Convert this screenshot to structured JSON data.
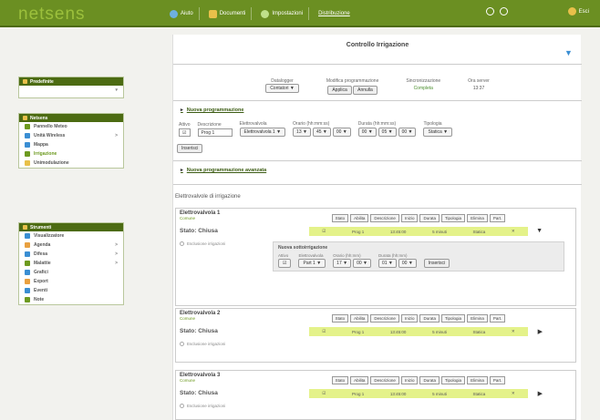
{
  "app": {
    "logo": "netsens"
  },
  "topnav": [
    {
      "icon": "help-icon",
      "label": "Aiuto"
    },
    {
      "icon": "folder-icon",
      "label": "Documenti"
    },
    {
      "icon": "settings-icon",
      "label": "Impostazioni"
    },
    {
      "icon": "",
      "label": "Distribuzione"
    }
  ],
  "topright": {
    "user": "Esci"
  },
  "sidebar": {
    "predefinite": {
      "title": "Predefinite"
    },
    "nav_panel": {
      "title": "Netsens",
      "items": [
        {
          "label": "Pannello Meteo",
          "icon": "weather-icon",
          "color": "#6d9a20",
          "active": false
        },
        {
          "label": "Unità Wireless",
          "icon": "wireless-icon",
          "color": "#3a8ed3",
          "active": false,
          "arrow": ">"
        },
        {
          "label": "Mappa",
          "icon": "map-icon",
          "color": "#3a8ed3",
          "active": false
        },
        {
          "label": "Irrigazione",
          "icon": "drop-icon",
          "color": "#6d9a20",
          "active": true
        },
        {
          "label": "Unimodulazione",
          "icon": "warning-icon",
          "color": "#e8c04a",
          "active": false
        }
      ]
    },
    "strumenti": {
      "title": "Strumenti",
      "items": [
        {
          "label": "Visualizzatore",
          "icon": "chart-icon",
          "color": "#3a8ed3",
          "arrow": ""
        },
        {
          "label": "Agenda",
          "icon": "calendar-icon",
          "color": "#e8a040",
          "arrow": ">"
        },
        {
          "label": "Difesa",
          "icon": "shield-icon",
          "color": "#3a8ed3",
          "arrow": ">"
        },
        {
          "label": "Malattie",
          "icon": "bug-icon",
          "color": "#6d9a20",
          "arrow": ">"
        },
        {
          "label": "Grafici",
          "icon": "graph-icon",
          "color": "#3a8ed3",
          "arrow": ""
        },
        {
          "label": "Export",
          "icon": "export-icon",
          "color": "#e8a040",
          "arrow": ""
        },
        {
          "label": "Eventi",
          "icon": "events-icon",
          "color": "#3a8ed3",
          "arrow": ""
        },
        {
          "label": "Note",
          "icon": "note-icon",
          "color": "#6d9a20",
          "arrow": ""
        }
      ]
    }
  },
  "main": {
    "title": "Controllo Irrigazione",
    "summary": [
      {
        "label": "Datalogger",
        "control": "select",
        "value": "Contatori"
      },
      {
        "label": "Modifica programmazione",
        "control": "buttons",
        "buttons": [
          "Applica",
          "Annulla"
        ]
      },
      {
        "label": "Sincronizzazione",
        "value": "Completa"
      },
      {
        "label": "Ora server",
        "value": "13:37"
      }
    ],
    "new_schedule_link": "Nuova programmazione",
    "form": {
      "attivo_label": "Attivo",
      "attivo_value": "☑",
      "desc_label": "Descrizione",
      "desc_value": "Prog 1",
      "ev_label": "Elettrovalvola",
      "ev_value": "Elettrovalvola 1",
      "start_label": "Orario (hh:mm:ss)",
      "start": [
        "13",
        "45",
        "00"
      ],
      "dur_label": "Durata (hh:mm:ss)",
      "dur": [
        "00",
        "05",
        "00"
      ],
      "type_label": "Tipologia",
      "type_value": "Statica",
      "insert_btn": "Inserisci"
    },
    "advanced_link": "Nuova programmazione avanzata",
    "elettrovalvole_title": "Elettrovalvole di irrigazione",
    "table_headers": [
      "Stato",
      "Abilita",
      "Descrizione",
      "Inizio",
      "Durata",
      "Tipologia",
      "Elimina",
      "Part."
    ],
    "valves": [
      {
        "name": "Elettrovalvola 1",
        "sub": "Comune",
        "stato": "Stato: Chiusa",
        "check": "Esclusione irrigazioni",
        "row": [
          "",
          "☑",
          "Prog 1",
          "13:45:00",
          "5 minuti",
          "Statica",
          "✕",
          ""
        ],
        "newprog": {
          "title": "Nuova sottoirrigazione",
          "attivo_label": "Attivo",
          "attivo_value": "☑",
          "part_label": "Elettrovalvola",
          "part_value": "Part 1",
          "start_label": "Orario (hh:mm)",
          "start": [
            "17",
            "00"
          ],
          "dur_label": "Durata (hh:mm)",
          "dur": [
            "01",
            "00"
          ],
          "btn": "Inserisci"
        }
      },
      {
        "name": "Elettrovalvola 2",
        "sub": "Comune",
        "stato": "Stato: Chiusa",
        "check": "Esclusione irrigazioni",
        "row": [
          "",
          "☑",
          "Prog 1",
          "13:45:00",
          "5 minuti",
          "Statica",
          "✕",
          ""
        ]
      },
      {
        "name": "Elettrovalvola 3",
        "sub": "Comune",
        "stato": "Stato: Chiusa",
        "check": "Esclusione irrigazioni",
        "row": [
          "",
          "☑",
          "Prog 1",
          "13:45:00",
          "5 minuti",
          "Statica",
          "✕",
          ""
        ]
      }
    ]
  }
}
